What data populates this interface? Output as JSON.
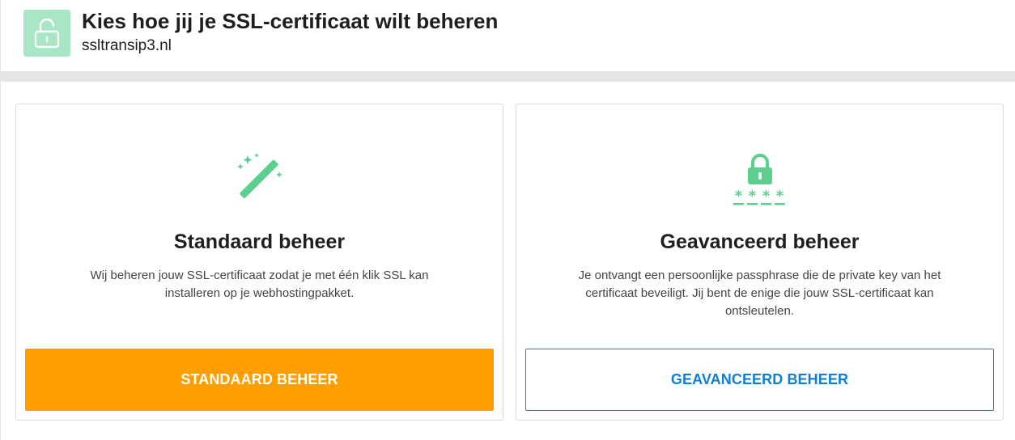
{
  "header": {
    "title": "Kies hoe jij je SSL-certificaat wilt beheren",
    "subtitle": "ssltransip3.nl",
    "icon": "padlock-open-icon"
  },
  "colors": {
    "accent_green": "#5ccf8f",
    "header_icon_bg": "#a8e6c6",
    "primary_button": "#ff9e00",
    "secondary_button_text": "#0f7fd6"
  },
  "options": [
    {
      "icon": "magic-wand-icon",
      "title": "Standaard beheer",
      "description": "Wij beheren jouw SSL-certificaat zodat je met één klik SSL kan installeren op je webhostingpakket.",
      "button_label": "STANDAARD BEHEER"
    },
    {
      "icon": "lock-passphrase-icon",
      "title": "Geavanceerd beheer",
      "description": "Je ontvangt een persoonlijke passphrase die de private key van het certificaat beveiligt. Jij bent de enige die jouw SSL-certificaat kan ontsleutelen.",
      "button_label": "GEAVANCEERD BEHEER"
    }
  ]
}
